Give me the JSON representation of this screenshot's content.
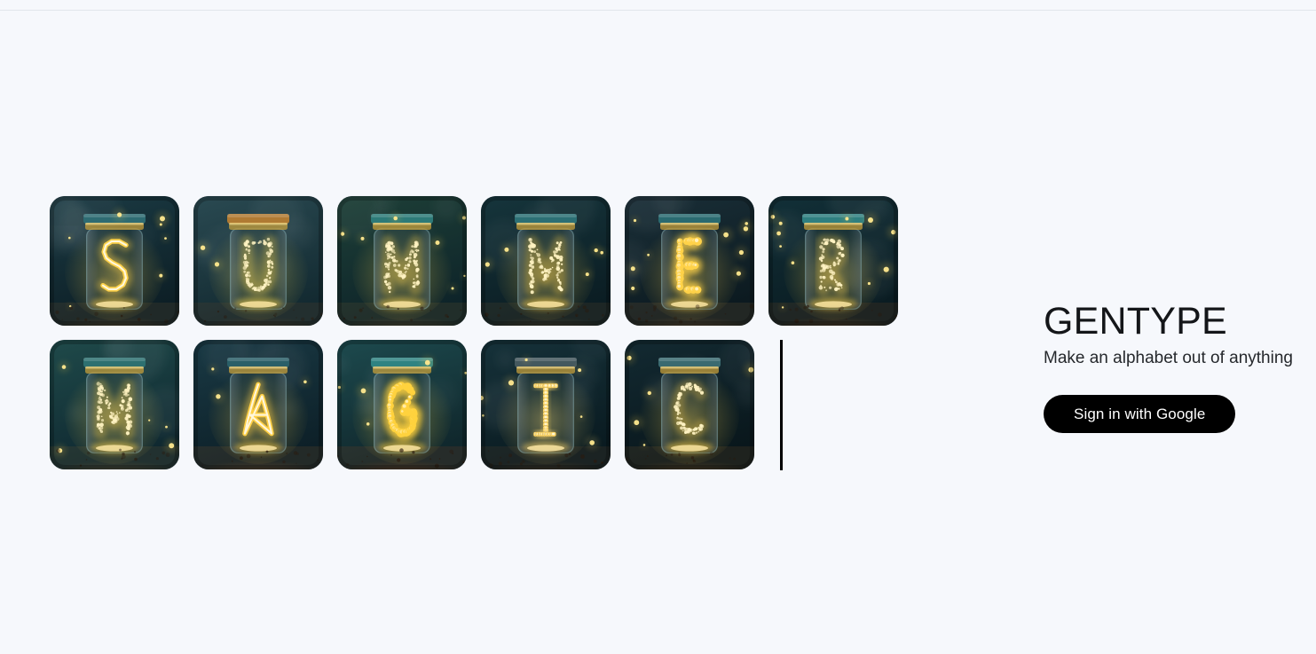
{
  "app": {
    "background_color": "#f6f8fc",
    "divider_color": "#e2e6ec"
  },
  "brand": {
    "title": "GENTYPE",
    "tagline": "Make an alphabet out of anything",
    "signin_label": "Sign in with Google",
    "signin_bg": "#000000",
    "signin_text_color": "#ffffff"
  },
  "canvas": {
    "theme": "glowing firefly letters inside glass mason jars at night",
    "tile_size": 146,
    "tile_gap": 16,
    "tile_radius": 17,
    "caret_visible": true,
    "rows": [
      {
        "word": "SUMMER",
        "caret": false,
        "tiles": [
          {
            "letter": "S",
            "style": "neon-outline",
            "bg_top": "#1b3b44",
            "bg_bottom": "#0d1f26",
            "glow": "#ffd24a",
            "lid": "#2e6b72",
            "ground": "#7a5a32"
          },
          {
            "letter": "U",
            "style": "firefly-dense",
            "bg_top": "#2a4a52",
            "bg_bottom": "#132a31",
            "glow": "#f7d64b",
            "lid": "#b07a33",
            "ground": "#6e4a28"
          },
          {
            "letter": "M",
            "style": "firefly-dense",
            "bg_top": "#1e4038",
            "bg_bottom": "#0e2429",
            "glow": "#ffd54d",
            "lid": "#2d7a78",
            "ground": "#7b5c33"
          },
          {
            "letter": "M",
            "style": "firefly-dense",
            "bg_top": "#16353c",
            "bg_bottom": "#0b1d23",
            "glow": "#ffd24a",
            "lid": "#2c6f74",
            "ground": "#6f5230"
          },
          {
            "letter": "E",
            "style": "bokeh-dots",
            "bg_top": "#1a2f38",
            "bg_bottom": "#0c1a20",
            "glow": "#ffd martyr",
            "lid": "#2a6a70",
            "ground": "#8a6338"
          },
          {
            "letter": "R",
            "style": "firefly-sparse",
            "bg_top": "#123038",
            "bg_bottom": "#0a1c22",
            "glow": "#ffd34b",
            "lid": "#2f7f80",
            "ground": "#7d4f25"
          }
        ]
      },
      {
        "word": "MAGIC",
        "caret": true,
        "tiles": [
          {
            "letter": "M",
            "style": "firefly-dense",
            "bg_top": "#1f4a4a",
            "bg_bottom": "#0f2830",
            "glow": "#ffd54d",
            "lid": "#2d7070",
            "ground": "#7a5c33"
          },
          {
            "letter": "A",
            "style": "neon-outline",
            "bg_top": "#1a3a45",
            "bg_bottom": "#0d2028",
            "glow": "#ffcf45",
            "lid": "#2a5f68",
            "ground": "#8a5a2e"
          },
          {
            "letter": "G",
            "style": "bokeh-dots",
            "bg_top": "#1d4a4e",
            "bg_bottom": "#10272c",
            "glow": "#ffd23f",
            "lid": "#2f8382",
            "ground": "#8a4a20"
          },
          {
            "letter": "I",
            "style": "bulb-strip",
            "bg_top": "#16323a",
            "bg_bottom": "#0a1b21",
            "glow": "#ffd86a",
            "lid": "#44585e",
            "ground": "#6a4a2a"
          },
          {
            "letter": "C",
            "style": "firefly-dense",
            "bg_top": "#132a32",
            "bg_bottom": "#09171c",
            "glow": "#ffd24a",
            "lid": "#3a6a70",
            "ground": "#7f5a2c"
          }
        ]
      }
    ]
  }
}
